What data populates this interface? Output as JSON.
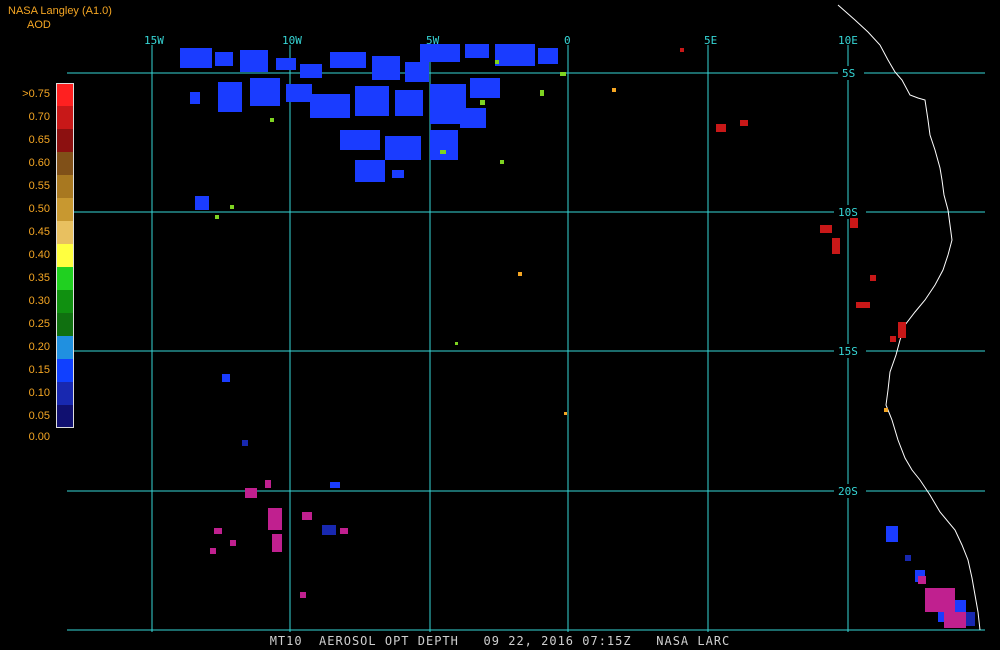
{
  "header": {
    "title": "NASA Langley (A1.0)",
    "subtitle": "AOD"
  },
  "legend": {
    "labels": [
      ">0.75",
      "0.70",
      "0.65",
      "0.60",
      "0.55",
      "0.50",
      "0.45",
      "0.40",
      "0.35",
      "0.30",
      "0.25",
      "0.20",
      "0.15",
      "0.10",
      "0.05",
      "0.00"
    ],
    "colors": [
      "#ff2020",
      "#c81818",
      "#8c1010",
      "#805018",
      "#a87820",
      "#c89830",
      "#e8c060",
      "#ffff40",
      "#20d020",
      "#109010",
      "#107010",
      "#2090e0",
      "#1040ff",
      "#1828b0",
      "#101070",
      "#b02090"
    ]
  },
  "axes": {
    "longitudes": [
      "15W",
      "10W",
      "5W",
      "0",
      "5E",
      "10E"
    ],
    "latitudes": [
      "5S",
      "10S",
      "15S",
      "20S"
    ],
    "grid_color": "#36d6d6"
  },
  "footer": {
    "caption": "MT10  AEROSOL OPT DEPTH   09 22, 2016 07:15Z   NASA LARC"
  },
  "colors": {
    "coastline": "#ffffff",
    "background": "#000000",
    "text_accent": "#f5a623"
  }
}
